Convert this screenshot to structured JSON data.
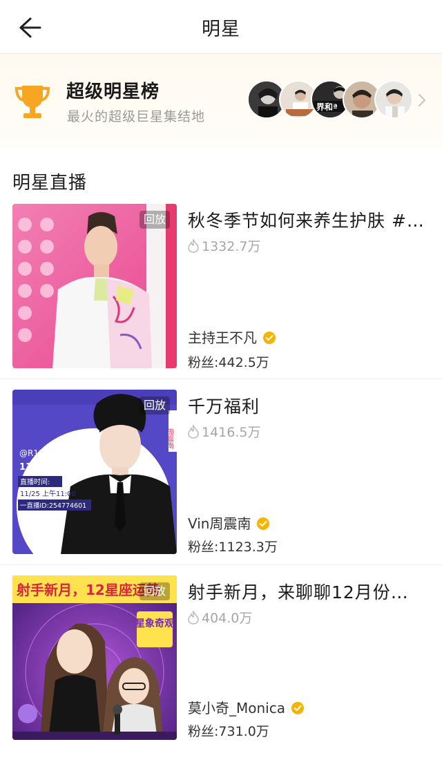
{
  "header": {
    "title": "明星",
    "back_icon": "arrow-left-icon"
  },
  "banner": {
    "title": "超级明星榜",
    "subtitle": "最火的超级巨星集结地",
    "icon": "trophy-icon",
    "avatar_count": 5,
    "avatar_badge_text": "界和ª"
  },
  "section": {
    "title": "明星直播"
  },
  "streams": [
    {
      "badge": "回放",
      "title": "秋冬季节如何来养生护肤 #…",
      "views": "1332.7万",
      "host": "主持王不凡",
      "fans": "粉丝:442.5万"
    },
    {
      "badge": "回放",
      "title": "千万福利",
      "views": "1416.5万",
      "host": "Vin周震南",
      "fans": "粉丝:1123.3万",
      "poster": {
        "handle": "@R1SE-周震南",
        "headline": "1100万粉丝福利",
        "time_label": "直播时间:",
        "time_value": "11/25  上午11:00",
        "room_id": "一直播ID:254774601",
        "side_text": "周震南"
      }
    },
    {
      "badge": "回放",
      "title": "射手新月，来聊聊12月份…",
      "views": "404.0万",
      "host": "莫小奇_Monica",
      "fans": "粉丝:731.0万",
      "poster": {
        "banner_text": "射手新月，12星座运势",
        "tag_text": "星象奇观"
      }
    }
  ],
  "colors": {
    "verified_badge": "#f5b400",
    "trophy": "#f6a623",
    "divider": "#eeeeee"
  }
}
